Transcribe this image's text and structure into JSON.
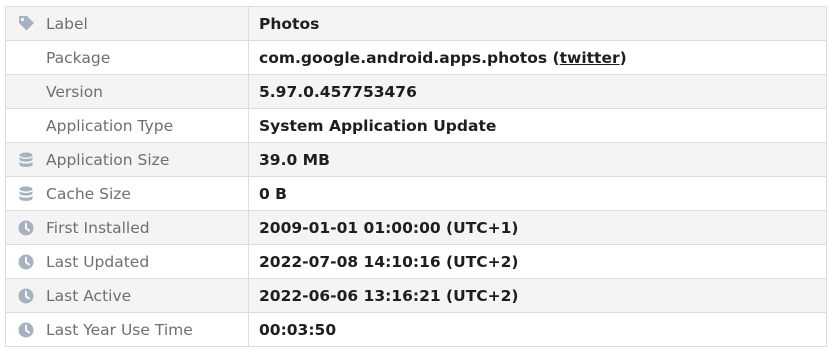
{
  "colors": {
    "icon": "#a7b2c0",
    "label": "#6f6f6f",
    "value": "#1e1e1e",
    "row_alt": "#f4f4f4",
    "border": "#dcdcdc"
  },
  "rows": [
    {
      "icon": "tag-icon",
      "label": "Label",
      "value": "Photos"
    },
    {
      "icon": "",
      "label": "Package",
      "value": "com.google.android.apps.photos",
      "link_prefix": "(",
      "link": "twitter",
      "link_suffix": ")"
    },
    {
      "icon": "",
      "label": "Version",
      "value": "5.97.0.457753476"
    },
    {
      "icon": "",
      "label": "Application Type",
      "value": "System Application Update"
    },
    {
      "icon": "database-icon",
      "label": "Application Size",
      "value": "39.0 MB"
    },
    {
      "icon": "database-icon",
      "label": "Cache Size",
      "value": "0 B"
    },
    {
      "icon": "clock-icon",
      "label": "First Installed",
      "value": "2009-01-01 01:00:00 (UTC+1)"
    },
    {
      "icon": "clock-icon",
      "label": "Last Updated",
      "value": "2022-07-08 14:10:16 (UTC+2)"
    },
    {
      "icon": "clock-icon",
      "label": "Last Active",
      "value": "2022-06-06 13:16:21 (UTC+2)"
    },
    {
      "icon": "clock-icon",
      "label": "Last Year Use Time",
      "value": "00:03:50"
    }
  ]
}
